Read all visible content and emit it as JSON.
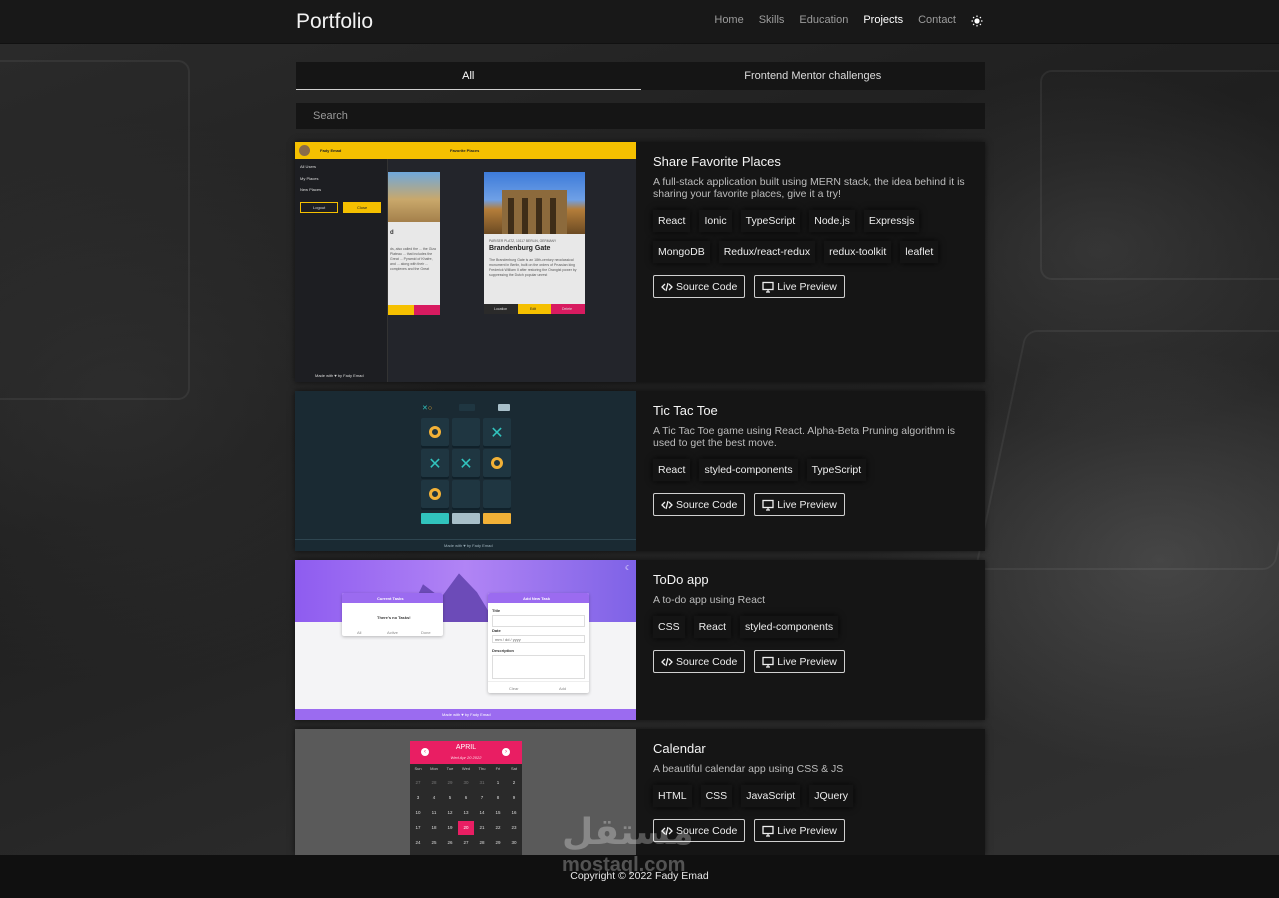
{
  "navbar": {
    "brand": "Portfolio",
    "links": [
      {
        "label": "Home",
        "active": false
      },
      {
        "label": "Skills",
        "active": false
      },
      {
        "label": "Education",
        "active": false
      },
      {
        "label": "Projects",
        "active": true
      },
      {
        "label": "Contact",
        "active": false
      }
    ],
    "theme_icon": "sun-icon"
  },
  "tabs": [
    {
      "label": "All",
      "active": true
    },
    {
      "label": "Frontend Mentor challenges",
      "active": false
    }
  ],
  "search": {
    "placeholder": "Search",
    "value": ""
  },
  "projects": [
    {
      "title": "Share Favorite Places",
      "description": "A full-stack application built using MERN stack, the idea behind it is sharing your favorite places, give it a try!",
      "tags": [
        "React",
        "Ionic",
        "TypeScript",
        "Node.js",
        "Expressjs",
        "MongoDB",
        "Redux/react-redux",
        "redux-toolkit",
        "leaflet"
      ],
      "source_label": "Source Code",
      "preview_label": "Live Preview",
      "thumb": {
        "user": "Fady Emad",
        "header": "Favorite Places",
        "menu": [
          "All Users",
          "My Places",
          "New Places"
        ],
        "logout": "Logout",
        "close": "Close",
        "place_location": "PARISER PLATZ, 10117 BERLIN, GERMANY",
        "place_title": "Brandenburg Gate",
        "place_desc": "The Brandenburg Gate is an 18th-century neoclassical monument in Berlin, built on the orders of Prussian king Frederick William II after restoring the Orangist power by suppressing the Dutch popular unrest",
        "left_desc": "ds, also called the ... the Giza Plateau ... that includes the Great ... Pyramid of Khafre, and ... along with their ... complexes and the Great",
        "location_btn": "Location",
        "edit_btn": "Edit",
        "delete_btn": "Delete",
        "footer": "Made with ♥ by Fady Emad"
      }
    },
    {
      "title": "Tic Tac Toe",
      "description": "A Tic Tac Toe game using React. Alpha-Beta Pruning algorithm is used to get the best move.",
      "tags": [
        "React",
        "styled-components",
        "TypeScript"
      ],
      "source_label": "Source Code",
      "preview_label": "Live Preview",
      "thumb": {
        "board": [
          "O",
          "",
          "X",
          "X",
          "X",
          "O",
          "O",
          "",
          ""
        ],
        "footer": "Made with ♥ by Fady Emad"
      }
    },
    {
      "title": "ToDo app",
      "description": "A to-do app using React",
      "tags": [
        "CSS",
        "React",
        "styled-components"
      ],
      "source_label": "Source Code",
      "preview_label": "Live Preview",
      "thumb": {
        "current_tasks": "Current Tasks",
        "no_tasks": "There's no Tasks!",
        "filters": [
          "All",
          "Active",
          "Done"
        ],
        "add_task": "Add New Task",
        "title_label": "Title",
        "date_label": "Date",
        "date_placeholder": "mm / dd / yyyy",
        "desc_label": "Description",
        "clear": "Clear",
        "add": "Add",
        "footer": "Made with ♥ by Fady Emad"
      }
    },
    {
      "title": "Calendar",
      "description": "A beautiful calendar app using CSS & JS",
      "tags": [
        "HTML",
        "CSS",
        "JavaScript",
        "JQuery"
      ],
      "source_label": "Source Code",
      "preview_label": "Live Preview",
      "thumb": {
        "month": "APRIL",
        "date": "Wed Apr 20 2022",
        "weekdays": [
          "Sun",
          "Mon",
          "Tue",
          "Wed",
          "Thu",
          "Fri",
          "Sat"
        ],
        "days": [
          "27",
          "28",
          "29",
          "30",
          "31",
          "1",
          "2",
          "3",
          "4",
          "5",
          "6",
          "7",
          "8",
          "9",
          "10",
          "11",
          "12",
          "13",
          "14",
          "15",
          "16",
          "17",
          "18",
          "19",
          "20",
          "21",
          "22",
          "23",
          "24",
          "25",
          "26",
          "27",
          "28",
          "29",
          "30"
        ],
        "selected": "20"
      }
    }
  ],
  "footer": {
    "copyright": "Copyright © 2022 Fady Emad"
  },
  "watermark": {
    "arabic": "مستقل",
    "latin": "mostaql.com"
  },
  "colors": {
    "accent_yellow": "#f5c000",
    "tictac_bg": "#1a2a33",
    "todo_purple": "#9b6bf0",
    "calendar_pink": "#e91e63"
  }
}
